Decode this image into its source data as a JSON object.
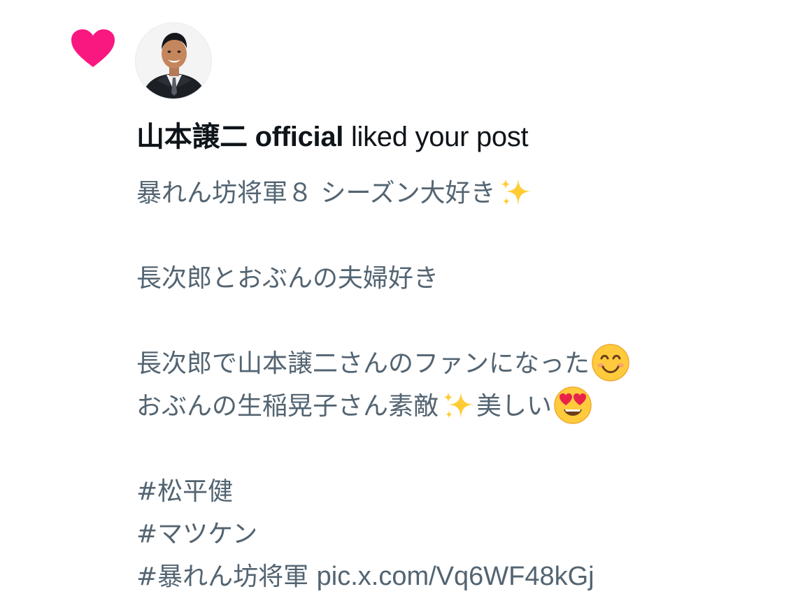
{
  "notification": {
    "user_name": "山本譲二 official",
    "action_text": " liked your post",
    "post_lines": [
      "暴れん坊将軍８ シーズン大好き",
      "",
      "長次郎とおぶんの夫婦好き",
      "",
      "長次郎で山本譲二さんのファンになった",
      "おぶんの生稲晃子さん素敵",
      "美しい",
      "",
      "#松平健",
      "#マツケン",
      "#暴れん坊将軍",
      "pic.x.com/Vq6WF48kGj"
    ]
  },
  "icons": {
    "like": "heart-icon",
    "sparkles": "sparkles-emoji",
    "smile": "smiling-face-emoji",
    "heart_eyes": "heart-eyes-emoji"
  },
  "colors": {
    "heart": "#f91880",
    "name_text": "#0f1419",
    "body_text": "#536471"
  }
}
